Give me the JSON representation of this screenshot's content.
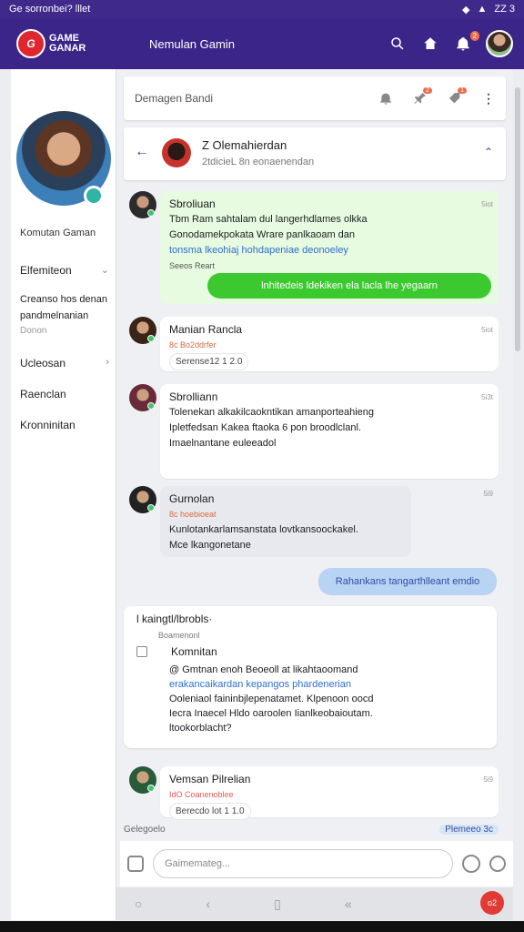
{
  "status": {
    "left": "Ge sorronbei? lllet",
    "right": "ZZ 3"
  },
  "appbar": {
    "logo_line1": "GAME",
    "logo_line2": "GANAR",
    "title": "Nemulan Gamin",
    "notif_badge": "2"
  },
  "sidebar": {
    "name": "Komutan Gaman",
    "items": [
      {
        "label": "Elfemiteon",
        "chevron": "⌄"
      },
      {
        "label": "Ucleosan",
        "chevron": "›"
      },
      {
        "label": "Raenclan",
        "chevron": ""
      },
      {
        "label": "Kronninitan",
        "chevron": ""
      }
    ],
    "multi_text": "Creanso hos denan pandmelnanian",
    "sub_text": "Donon"
  },
  "search": {
    "placeholder": "Demagen Bandi",
    "badge1": "2",
    "badge2": "1"
  },
  "chat_header": {
    "name": "Z Olemahierdan",
    "sub": "2tdicieL 8n eonaenendan"
  },
  "messages": [
    {
      "name": "Sbroliuan",
      "time": "5iot",
      "line1": "Tbm Ram sahtalam dul langerhdlames olkka",
      "line2": "Gonodamekpokata Wrare panlkaoam dan",
      "link": "tonsma lkeohiaj hohdapeniae deonoeley",
      "tag": "Seeos Reart",
      "pill": "lnhitedeis ldekiken ela lacla lhe yegaarn"
    },
    {
      "name": "Manian Rancla",
      "tag": "8c Bo2ddrfer",
      "reaction": "Serense12 1 2.0",
      "time": "5iot"
    },
    {
      "name": "Sbrolliann",
      "time": "5i3t",
      "line1": "Tolenekan alkakilcaokntikan amanporteahieng",
      "line2": "Ipletfedsan Kakea ftaoka 6 pon broodlclanl.",
      "line3": "Imaelnantane euleeadol"
    },
    {
      "name": "Gurnolan",
      "time": "5i9",
      "tag": "8c hoebioeat",
      "line1": "Kunlotankarlamsanstata lovtkansoockakel.",
      "line2": "Mce lkangonetane"
    },
    {
      "pill": "Rahankans tangarthlleant emdio"
    },
    {
      "thread_title": "l kaingtl/lbrobls·",
      "thread_sub": "Boamenonl",
      "author": "Komnitan",
      "line1": "@ Gmtnan enoh Beoeoll at likahtaoomand",
      "line2": "erakancaikardan kepangos phardenerian",
      "line3": "Ooleniaol faininbjlepenatamet. Klpenoon oocd",
      "line4": "Iecra Inaecel Hldo oaroolen Iianlkeobaioutam.",
      "line5": "ltookorblacht?"
    },
    {
      "name": "Vemsan Pilrelian",
      "tag": "IdO Coanenoblee",
      "reaction": "Berecdo lot 1 1.0",
      "time": "5i9"
    }
  ],
  "compose": {
    "strip_left": "Gelegoelo",
    "strip_right": "Plemeeo 3c",
    "placeholder": "Gaimemateg..."
  },
  "nav": {
    "fab": "o2"
  }
}
